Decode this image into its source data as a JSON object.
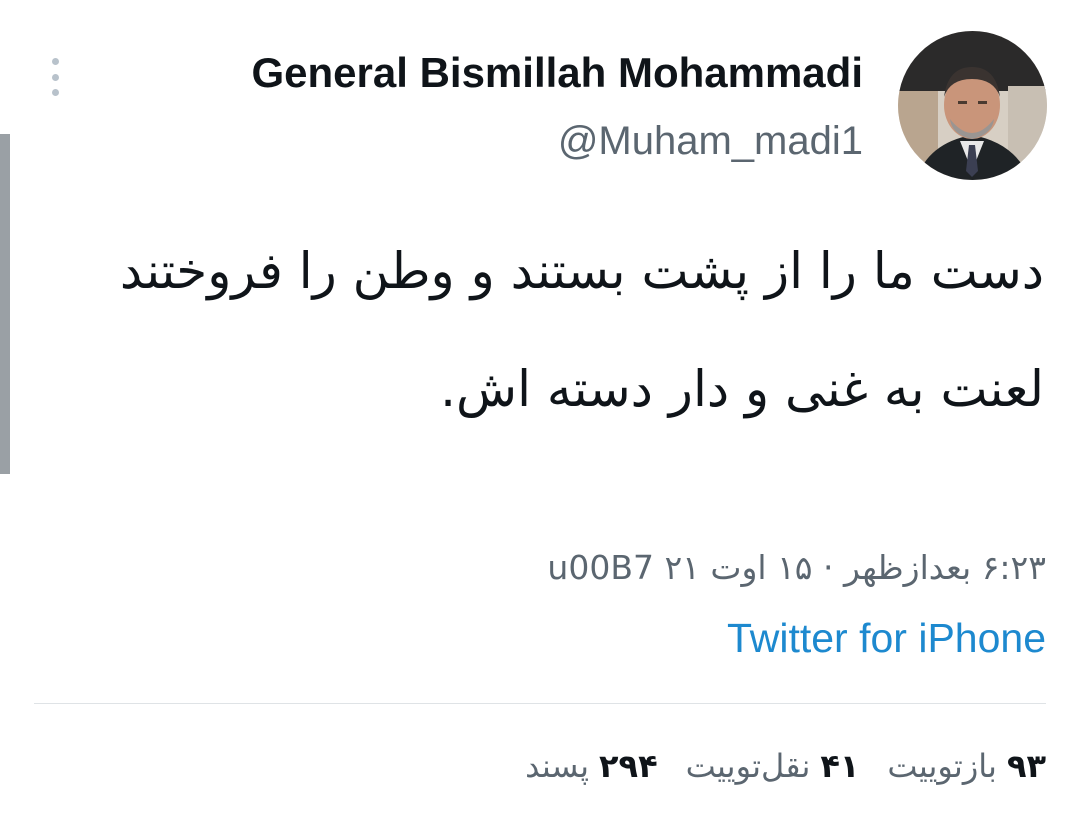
{
  "author": {
    "name": "General Bismillah Mohammadi",
    "handle": "@Muham_madi1"
  },
  "tweet": {
    "text": "دست ما را از پشت بستند و وطن را فروختند لعنت به غنی و دار دسته اش.",
    "timestamp": "۶:۲۳ بعدازظهر · ۱۵ اوت ۲۱ u00B7",
    "source": "Twitter for iPhone"
  },
  "stats": {
    "retweets": {
      "count": "۹۳",
      "label": "بازتوییت"
    },
    "quotes": {
      "count": "۴۱",
      "label": "نقل‌توییت"
    },
    "likes": {
      "count": "۲۹۴",
      "label": "پسند"
    }
  },
  "icons": {
    "more": "more-vertical-icon"
  },
  "colors": {
    "link": "#1d89cf",
    "secondary_text": "#5b6670",
    "primary_text": "#0f1419"
  }
}
